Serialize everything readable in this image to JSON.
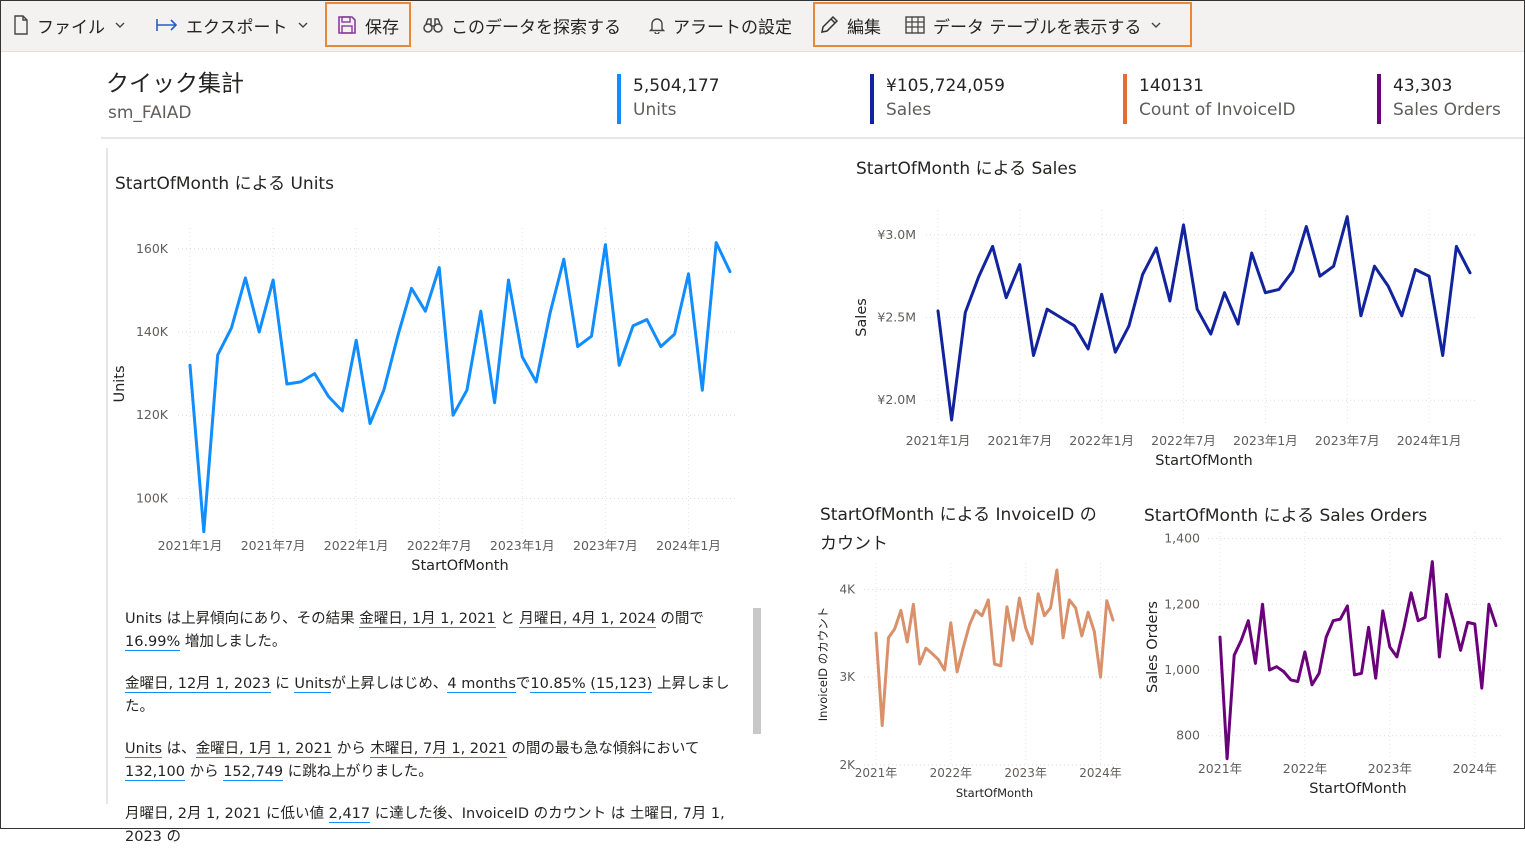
{
  "toolbar": {
    "file": "ファイル",
    "export": "エクスポート",
    "save": "保存",
    "explore": "このデータを探索する",
    "alert": "アラートの設定",
    "edit": "編集",
    "show_table": "データ テーブルを表示する"
  },
  "header": {
    "title": "クイック集計",
    "subtitle": "sm_FAIAD"
  },
  "kpis": [
    {
      "value": "5,504,177",
      "label": "Units",
      "color": "#118dff"
    },
    {
      "value": "¥105,724,059",
      "label": "Sales",
      "color": "#12239e"
    },
    {
      "value": "140131",
      "label": "Count of InvoiceID",
      "color": "#e66c37"
    },
    {
      "value": "43,303",
      "label": "Sales Orders",
      "color": "#6b007b"
    }
  ],
  "chart_data": [
    {
      "type": "line",
      "title": "StartOfMonth による Units",
      "xlabel": "StartOfMonth",
      "ylabel": "Units",
      "color": "#118dff",
      "x_start": "2021-01",
      "x_ticks": [
        "2021年1月",
        "2021年7月",
        "2022年1月",
        "2022年7月",
        "2023年1月",
        "2023年7月",
        "2024年1月"
      ],
      "y_ticks": [
        "100K",
        "120K",
        "140K",
        "160K"
      ],
      "y_tick_values": [
        100000,
        120000,
        140000,
        160000
      ],
      "ylim": [
        90000,
        165000
      ],
      "values": [
        132000,
        92000,
        134500,
        141000,
        153000,
        140000,
        152500,
        127500,
        128000,
        130000,
        124500,
        121000,
        138000,
        118000,
        126000,
        139000,
        150500,
        145000,
        155500,
        120000,
        126000,
        145000,
        123000,
        152500,
        134000,
        128000,
        144500,
        157500,
        136500,
        139000,
        161000,
        132000,
        141500,
        143000,
        136500,
        139500,
        154000,
        126000,
        161500,
        154500
      ]
    },
    {
      "type": "line",
      "title": "StartOfMonth による Sales",
      "xlabel": "StartOfMonth",
      "ylabel": "Sales",
      "color": "#12239e",
      "x_start": "2021-01",
      "x_ticks": [
        "2021年1月",
        "2021年7月",
        "2022年1月",
        "2022年7月",
        "2023年1月",
        "2023年7月",
        "2024年1月"
      ],
      "y_ticks": [
        "¥2.0M",
        "¥2.5M",
        "¥3.0M"
      ],
      "y_tick_values": [
        2000000,
        2500000,
        3000000
      ],
      "ylim": [
        1850000,
        3150000
      ],
      "values": [
        2540000,
        1880000,
        2530000,
        2750000,
        2930000,
        2620000,
        2820000,
        2270000,
        2550000,
        2500000,
        2450000,
        2310000,
        2640000,
        2290000,
        2450000,
        2760000,
        2920000,
        2600000,
        3060000,
        2550000,
        2400000,
        2650000,
        2460000,
        2890000,
        2650000,
        2670000,
        2780000,
        3050000,
        2750000,
        2810000,
        3110000,
        2510000,
        2810000,
        2690000,
        2510000,
        2790000,
        2750000,
        2270000,
        2930000,
        2770000
      ]
    },
    {
      "type": "line",
      "title": "StartOfMonth による InvoiceID のカウント",
      "xlabel": "StartOfMonth",
      "ylabel": "InvoiceID のカウント",
      "color": "#d9916b",
      "x_start": "2021-01",
      "x_ticks": [
        "2021年",
        "2022年",
        "2023年",
        "2024年"
      ],
      "y_ticks": [
        "2K",
        "3K",
        "4K"
      ],
      "y_tick_values": [
        2000,
        3000,
        4000
      ],
      "ylim": [
        2000,
        4300
      ],
      "values": [
        3500,
        2450,
        3450,
        3550,
        3760,
        3400,
        3830,
        3150,
        3330,
        3270,
        3200,
        3080,
        3620,
        3060,
        3340,
        3600,
        3760,
        3700,
        3880,
        3150,
        3130,
        3800,
        3420,
        3900,
        3560,
        3380,
        3950,
        3700,
        3790,
        4220,
        3450,
        3880,
        3790,
        3470,
        3740,
        3520,
        3000,
        3870,
        3650
      ]
    },
    {
      "type": "line",
      "title": "StartOfMonth による Sales Orders",
      "xlabel": "StartOfMonth",
      "ylabel": "Sales Orders",
      "color": "#6b007b",
      "x_start": "2021-01",
      "x_ticks": [
        "2021年",
        "2022年",
        "2023年",
        "2024年"
      ],
      "y_ticks": [
        "800",
        "1,000",
        "1,200",
        "1,400"
      ],
      "y_tick_values": [
        800,
        1000,
        1200,
        1400
      ],
      "ylim": [
        720,
        1420
      ],
      "values": [
        1100,
        730,
        1045,
        1090,
        1150,
        1020,
        1200,
        1000,
        1010,
        995,
        970,
        965,
        1055,
        955,
        990,
        1100,
        1150,
        1155,
        1195,
        985,
        990,
        1130,
        975,
        1180,
        1070,
        1040,
        1130,
        1235,
        1150,
        1160,
        1330,
        1040,
        1230,
        1150,
        1060,
        1145,
        1140,
        945,
        1200,
        1135
      ]
    }
  ],
  "narrative": {
    "p1": [
      "Units は上昇傾向にあり、その結果 ",
      "金曜日, 1月 1, 2021",
      " と ",
      "月曜日, 4月 1, 2024",
      " の間で ",
      "16.99%",
      " 増加しました。"
    ],
    "p2": [
      "金曜日, 12月 1, 2023",
      " に ",
      "Units",
      "が上昇しはじめ、",
      "4 months",
      "で",
      "10.85%",
      " ",
      "(15,123)",
      " 上昇しました。"
    ],
    "p3": [
      "Units",
      " は、",
      "金曜日, 1月 1, 2021",
      " から ",
      "木曜日, 7月 1, 2021",
      " の間の最も急な傾斜において ",
      "132,100",
      " から ",
      "152,749",
      " に跳ね上がりました。"
    ],
    "p4": [
      "月曜日, 2月 1, 2021 に低い値 ",
      "2,417",
      " に達した後、InvoiceID のカウント は 土曜日, 7月 1, 2023 の"
    ]
  }
}
